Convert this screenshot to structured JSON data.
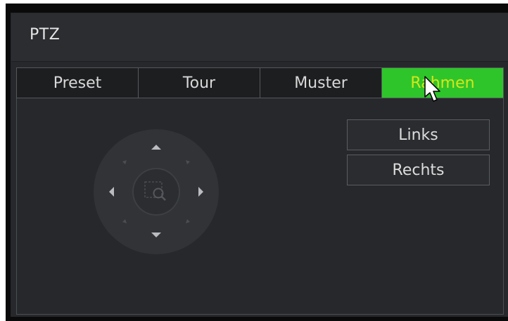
{
  "window": {
    "title": "PTZ"
  },
  "tabs": [
    {
      "label": "Preset",
      "active": false
    },
    {
      "label": "Tour",
      "active": false
    },
    {
      "label": "Muster",
      "active": false
    },
    {
      "label": "Rahmen",
      "active": true
    }
  ],
  "buttons": {
    "left_label": "Links",
    "right_label": "Rechts"
  },
  "joystick": {
    "controls": [
      "arrow-up-icon",
      "arrow-down-icon",
      "arrow-left-icon",
      "arrow-right-icon",
      "zoom-focus-icon"
    ]
  },
  "colors": {
    "active_tab_bg": "#2ec52b",
    "active_tab_text": "#d6e619",
    "panel_bg": "#26282b"
  }
}
